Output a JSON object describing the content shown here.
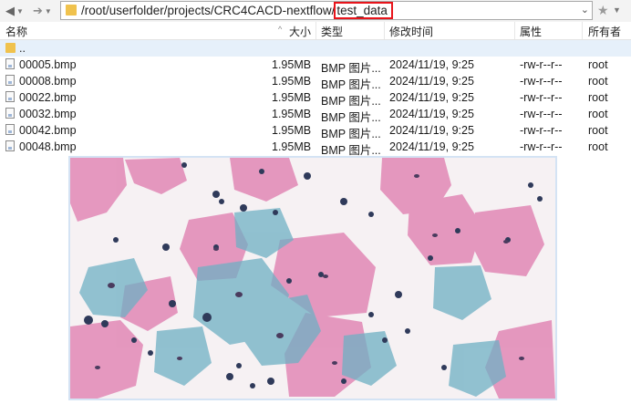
{
  "toolbar": {
    "back_label": "◂ ▾",
    "forward_label": "➜ ▾",
    "path_prefix": "/root/userfolder/projects/CRC4CACD-nextflow/",
    "path_highlight": "test_data"
  },
  "columns": {
    "name": "名称",
    "size": "大小",
    "type": "类型",
    "mtime": "修改时间",
    "attr": "属性",
    "owner": "所有者"
  },
  "parent_label": "..",
  "files": [
    {
      "name": "00005.bmp",
      "size": "1.95MB",
      "type": "BMP 图片...",
      "mtime": "2024/11/19, 9:25",
      "attr": "-rw-r--r--",
      "owner": "root"
    },
    {
      "name": "00008.bmp",
      "size": "1.95MB",
      "type": "BMP 图片...",
      "mtime": "2024/11/19, 9:25",
      "attr": "-rw-r--r--",
      "owner": "root"
    },
    {
      "name": "00022.bmp",
      "size": "1.95MB",
      "type": "BMP 图片...",
      "mtime": "2024/11/19, 9:25",
      "attr": "-rw-r--r--",
      "owner": "root"
    },
    {
      "name": "00032.bmp",
      "size": "1.95MB",
      "type": "BMP 图片...",
      "mtime": "2024/11/19, 9:25",
      "attr": "-rw-r--r--",
      "owner": "root"
    },
    {
      "name": "00042.bmp",
      "size": "1.95MB",
      "type": "BMP 图片...",
      "mtime": "2024/11/19, 9:25",
      "attr": "-rw-r--r--",
      "owner": "root"
    },
    {
      "name": "00048.bmp",
      "size": "1.95MB",
      "type": "BMP 图片...",
      "mtime": "2024/11/19, 9:25",
      "attr": "-rw-r--r--",
      "owner": "root"
    }
  ],
  "colors": {
    "highlight_box": "#e8141b",
    "parent_row_bg": "#e6f0fa",
    "folder": "#f0c24d",
    "preview_border": "#d4e3f4"
  }
}
